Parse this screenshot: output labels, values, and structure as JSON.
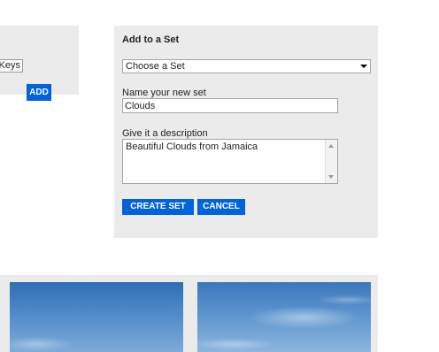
{
  "tags": {
    "input_value": "s Keys",
    "add_label": "ADD"
  },
  "set_panel": {
    "title": "Add to a Set",
    "select_value": "Choose a Set",
    "name_label": "Name your new set",
    "name_value": "Clouds",
    "description_label": "Give it a description",
    "description_value": "Beautiful Clouds from Jamaica",
    "create_label": "CREATE SET",
    "cancel_label": "CANCEL"
  },
  "colors": {
    "accent_button": "#0063dc",
    "panel_background": "#ebebeb"
  },
  "photos": [
    {
      "name": "photo-thumbnail",
      "description_icon": "sky-photo"
    },
    {
      "name": "photo-thumbnail",
      "description_icon": "clouds-photo"
    }
  ]
}
